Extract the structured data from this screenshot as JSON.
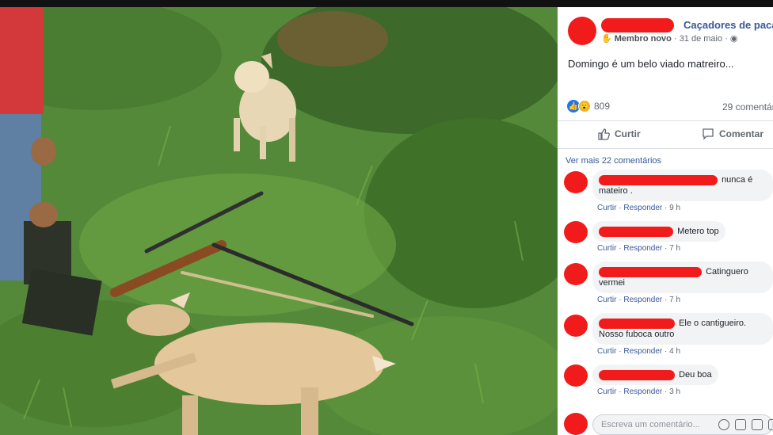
{
  "post": {
    "group_name": "Caçadores de paca",
    "member_badge": "Membro novo",
    "date": "31 de maio",
    "text": "Domingo é um belo viado matreiro...",
    "reaction_count": "809",
    "comments_count": "29 comentár",
    "like_label": "Curtir",
    "comment_label": "Comentar",
    "more_comments": "Ver mais 22 comentários"
  },
  "comments": [
    {
      "text": "nunca é mateiro .",
      "like": "Curtir",
      "reply": "Responder",
      "time": "9 h"
    },
    {
      "text": "Metero top",
      "like": "Curtir",
      "reply": "Responder",
      "time": "7 h"
    },
    {
      "text": "Catinguero vermei",
      "like": "Curtir",
      "reply": "Responder",
      "time": "7 h"
    },
    {
      "text": "Ele o cantigueiro. Nosso fuboca outro",
      "like": "Curtir",
      "reply": "Responder",
      "time": "4 h"
    },
    {
      "text": "Deu boa",
      "like": "Curtir",
      "reply": "Responder",
      "time": "3 h"
    }
  ],
  "composer": {
    "placeholder": "Escreva um comentário...",
    "icons": [
      "emoji-icon",
      "camera-icon",
      "gif-icon",
      "sticker-icon"
    ]
  },
  "colors": {
    "redaction": "#f21b1b",
    "link": "#385898",
    "like_blue": "#1877f2"
  }
}
